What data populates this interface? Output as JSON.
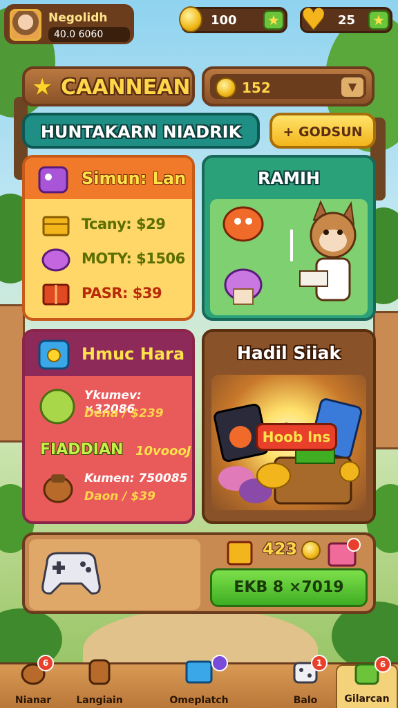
{
  "profile": {
    "name": "Negolidh",
    "coins": "40.0 6060"
  },
  "resources": {
    "gems": {
      "value": "100"
    },
    "hearts": {
      "value": "25"
    }
  },
  "header": {
    "title": "CAANNEAN",
    "dropdown_value": "152"
  },
  "tabs": {
    "main_label": "HUNTAKARN NIADRIK",
    "gold_label": "+ GODSUN"
  },
  "shop_simun": {
    "title": "Simun: Lan",
    "items": [
      {
        "label": "Tcany: $29",
        "icon": "gold-box-icon"
      },
      {
        "label": "MOTY: $1506",
        "icon": "purple-bag-icon"
      },
      {
        "label": "PASR: $39",
        "icon": "red-box-icon"
      }
    ]
  },
  "shop_ramih": {
    "title": "RAMIH"
  },
  "shop_hmuc": {
    "title": "Hmuc Hara",
    "line1": "Ykumev: ×32086",
    "line2": "Dena / $239",
    "mid_left": "FIADDIAN",
    "mid_right": "10voooJ",
    "line3": "Kumen: 750085",
    "line4": "Daon / $39"
  },
  "shop_hadil": {
    "title": "Hadil Siiak",
    "sign": "Hoob lns"
  },
  "bottom_panel": {
    "count": "423",
    "buy_label": "EKB 8 ×7019"
  },
  "nav": [
    {
      "label": "Nianar",
      "icon": "squirrel-icon",
      "badge": "6"
    },
    {
      "label": "Langiain",
      "icon": "barrel-icon",
      "badge": ""
    },
    {
      "label": "Omeplatch",
      "icon": "blue-chest-icon",
      "badge": ""
    },
    {
      "label": "Balo",
      "icon": "dice-icon",
      "badge": "1"
    },
    {
      "label": "Gilarcan",
      "icon": "green-puzzle-icon",
      "badge": "6"
    }
  ],
  "colors": {
    "accent_gold": "#ffd54a",
    "wood": "#8a5228",
    "teal": "#1f8f86",
    "buy_green": "#3fae23"
  }
}
